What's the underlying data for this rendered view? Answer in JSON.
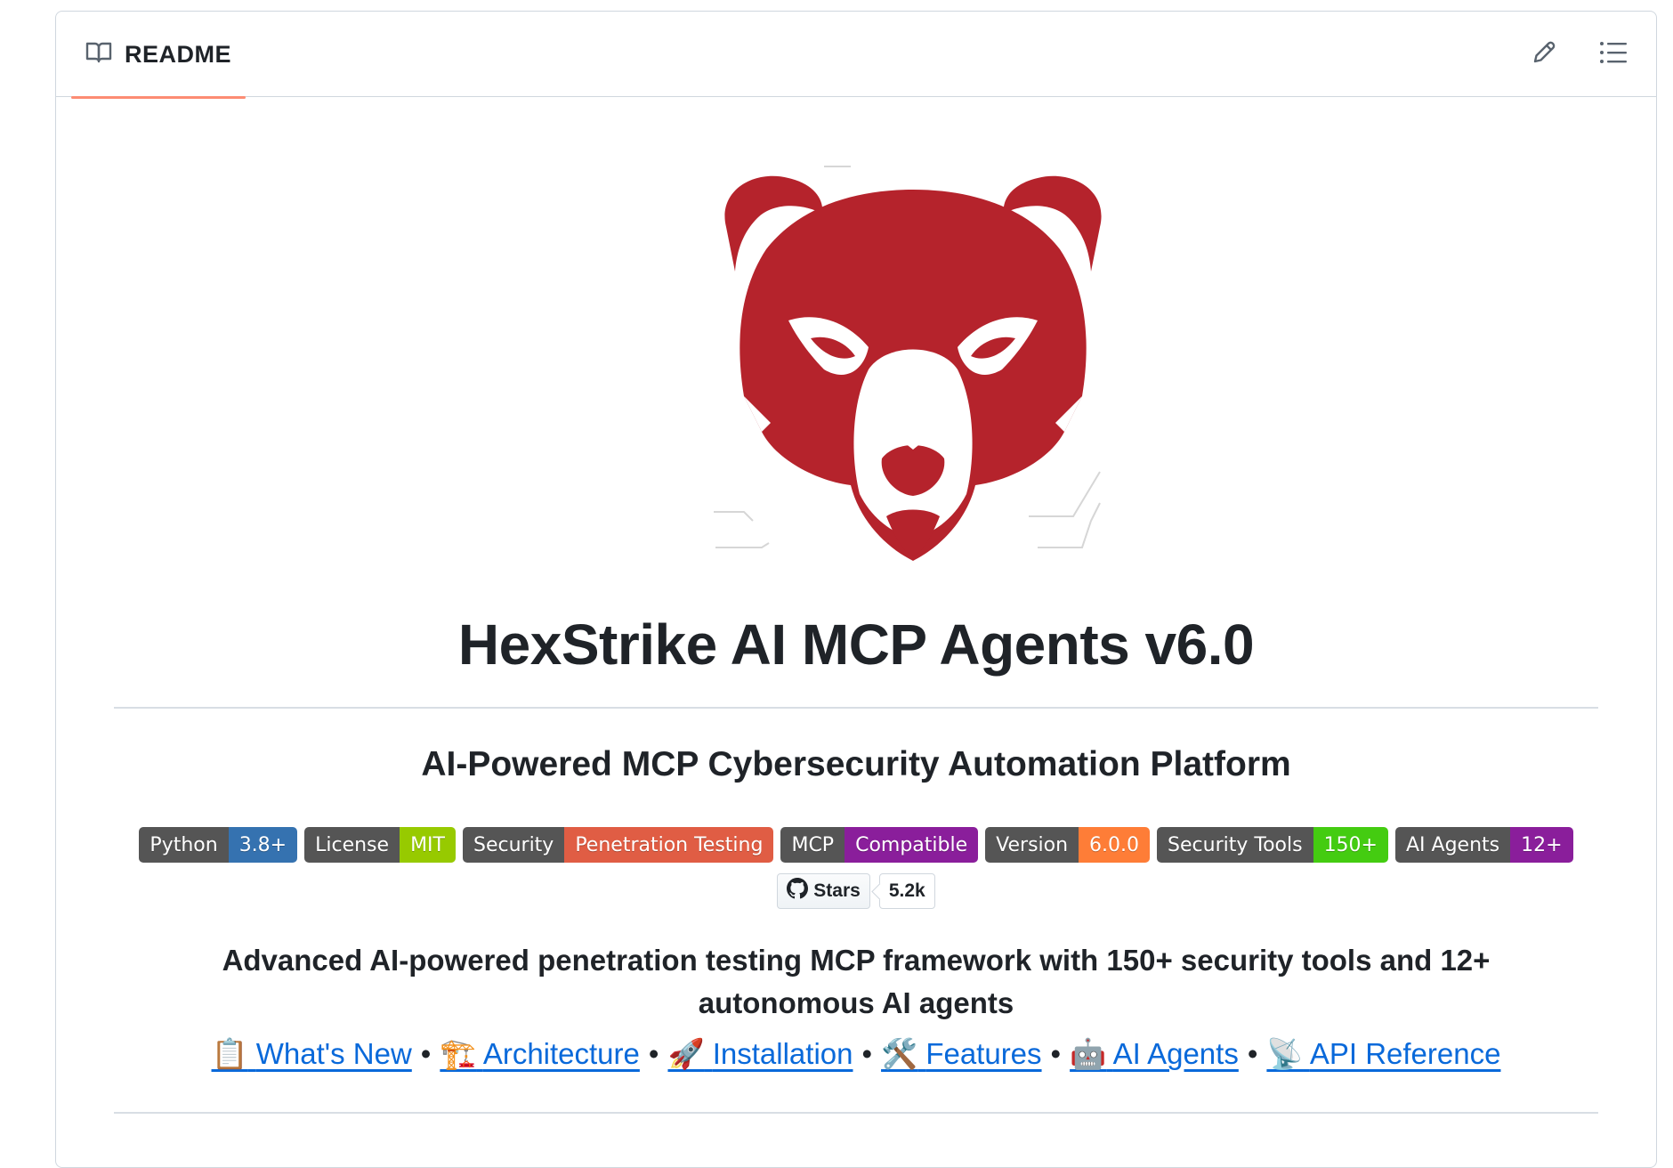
{
  "header": {
    "tab_label": "README",
    "edit_icon": "pencil-icon",
    "outline_icon": "list-icon"
  },
  "logo": {
    "icon": "red-bear-logo"
  },
  "title": "HexStrike AI MCP Agents v6.0",
  "subtitle": "AI-Powered MCP Cybersecurity Automation Platform",
  "badges": [
    {
      "label": "Python",
      "value": "3.8+",
      "color": "#3572b0"
    },
    {
      "label": "License",
      "value": "MIT",
      "color": "#97ca00"
    },
    {
      "label": "Security",
      "value": "Penetration Testing",
      "color": "#e05d44"
    },
    {
      "label": "MCP",
      "value": "Compatible",
      "color": "#8a1e9b"
    },
    {
      "label": "Version",
      "value": "6.0.0",
      "color": "#fe7d37"
    },
    {
      "label": "Security Tools",
      "value": "150+",
      "color": "#4c1"
    },
    {
      "label": "AI Agents",
      "value": "12+",
      "color": "#8a1e9b"
    }
  ],
  "stars": {
    "label": "Stars",
    "count": "5.2k"
  },
  "description": "Advanced AI-powered penetration testing MCP framework with 150+ security tools and 12+ autonomous AI agents",
  "nav_links": [
    {
      "emoji": "📋",
      "label": "What's New"
    },
    {
      "emoji": "🏗️",
      "label": "Architecture"
    },
    {
      "emoji": "🚀",
      "label": "Installation"
    },
    {
      "emoji": "🛠️",
      "label": "Features"
    },
    {
      "emoji": "🤖",
      "label": "AI Agents"
    },
    {
      "emoji": "📡",
      "label": "API Reference"
    }
  ],
  "nav_separator": "•"
}
